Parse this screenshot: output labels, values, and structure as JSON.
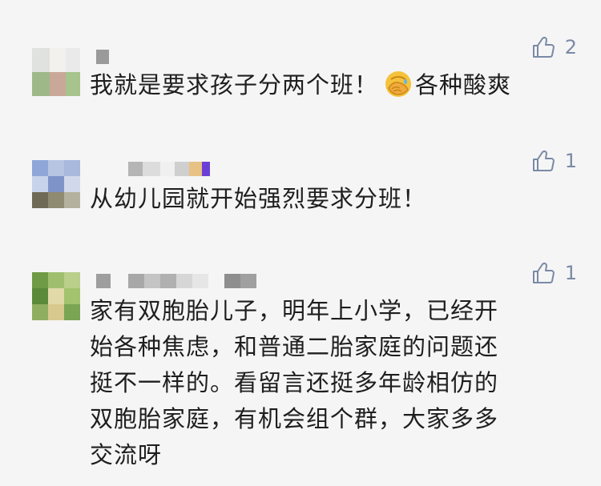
{
  "comments": [
    {
      "likes": "2",
      "text_before_emoji": "我就是要求孩子分两个班！",
      "emoji": "face-palm-emoji",
      "text_after_emoji": "各种酸爽"
    },
    {
      "likes": "1",
      "text": "从幼儿园就开始强烈要求分班！"
    },
    {
      "likes": "1",
      "lines": [
        "家有双胞胎儿子，明年上小学，已经开",
        "始各种焦虑，和普通二胎家庭的问题还",
        "挺不一样的。看留言还挺多年龄相仿的",
        "双胞胎家庭，有机会组个群，大家多多",
        "交流呀"
      ]
    }
  ],
  "colors": {
    "background": "#f5f5f5",
    "text": "#1e1e1e",
    "like_icon": "#7a8aa6"
  },
  "icons": {
    "like": "thumbs-up-icon"
  }
}
